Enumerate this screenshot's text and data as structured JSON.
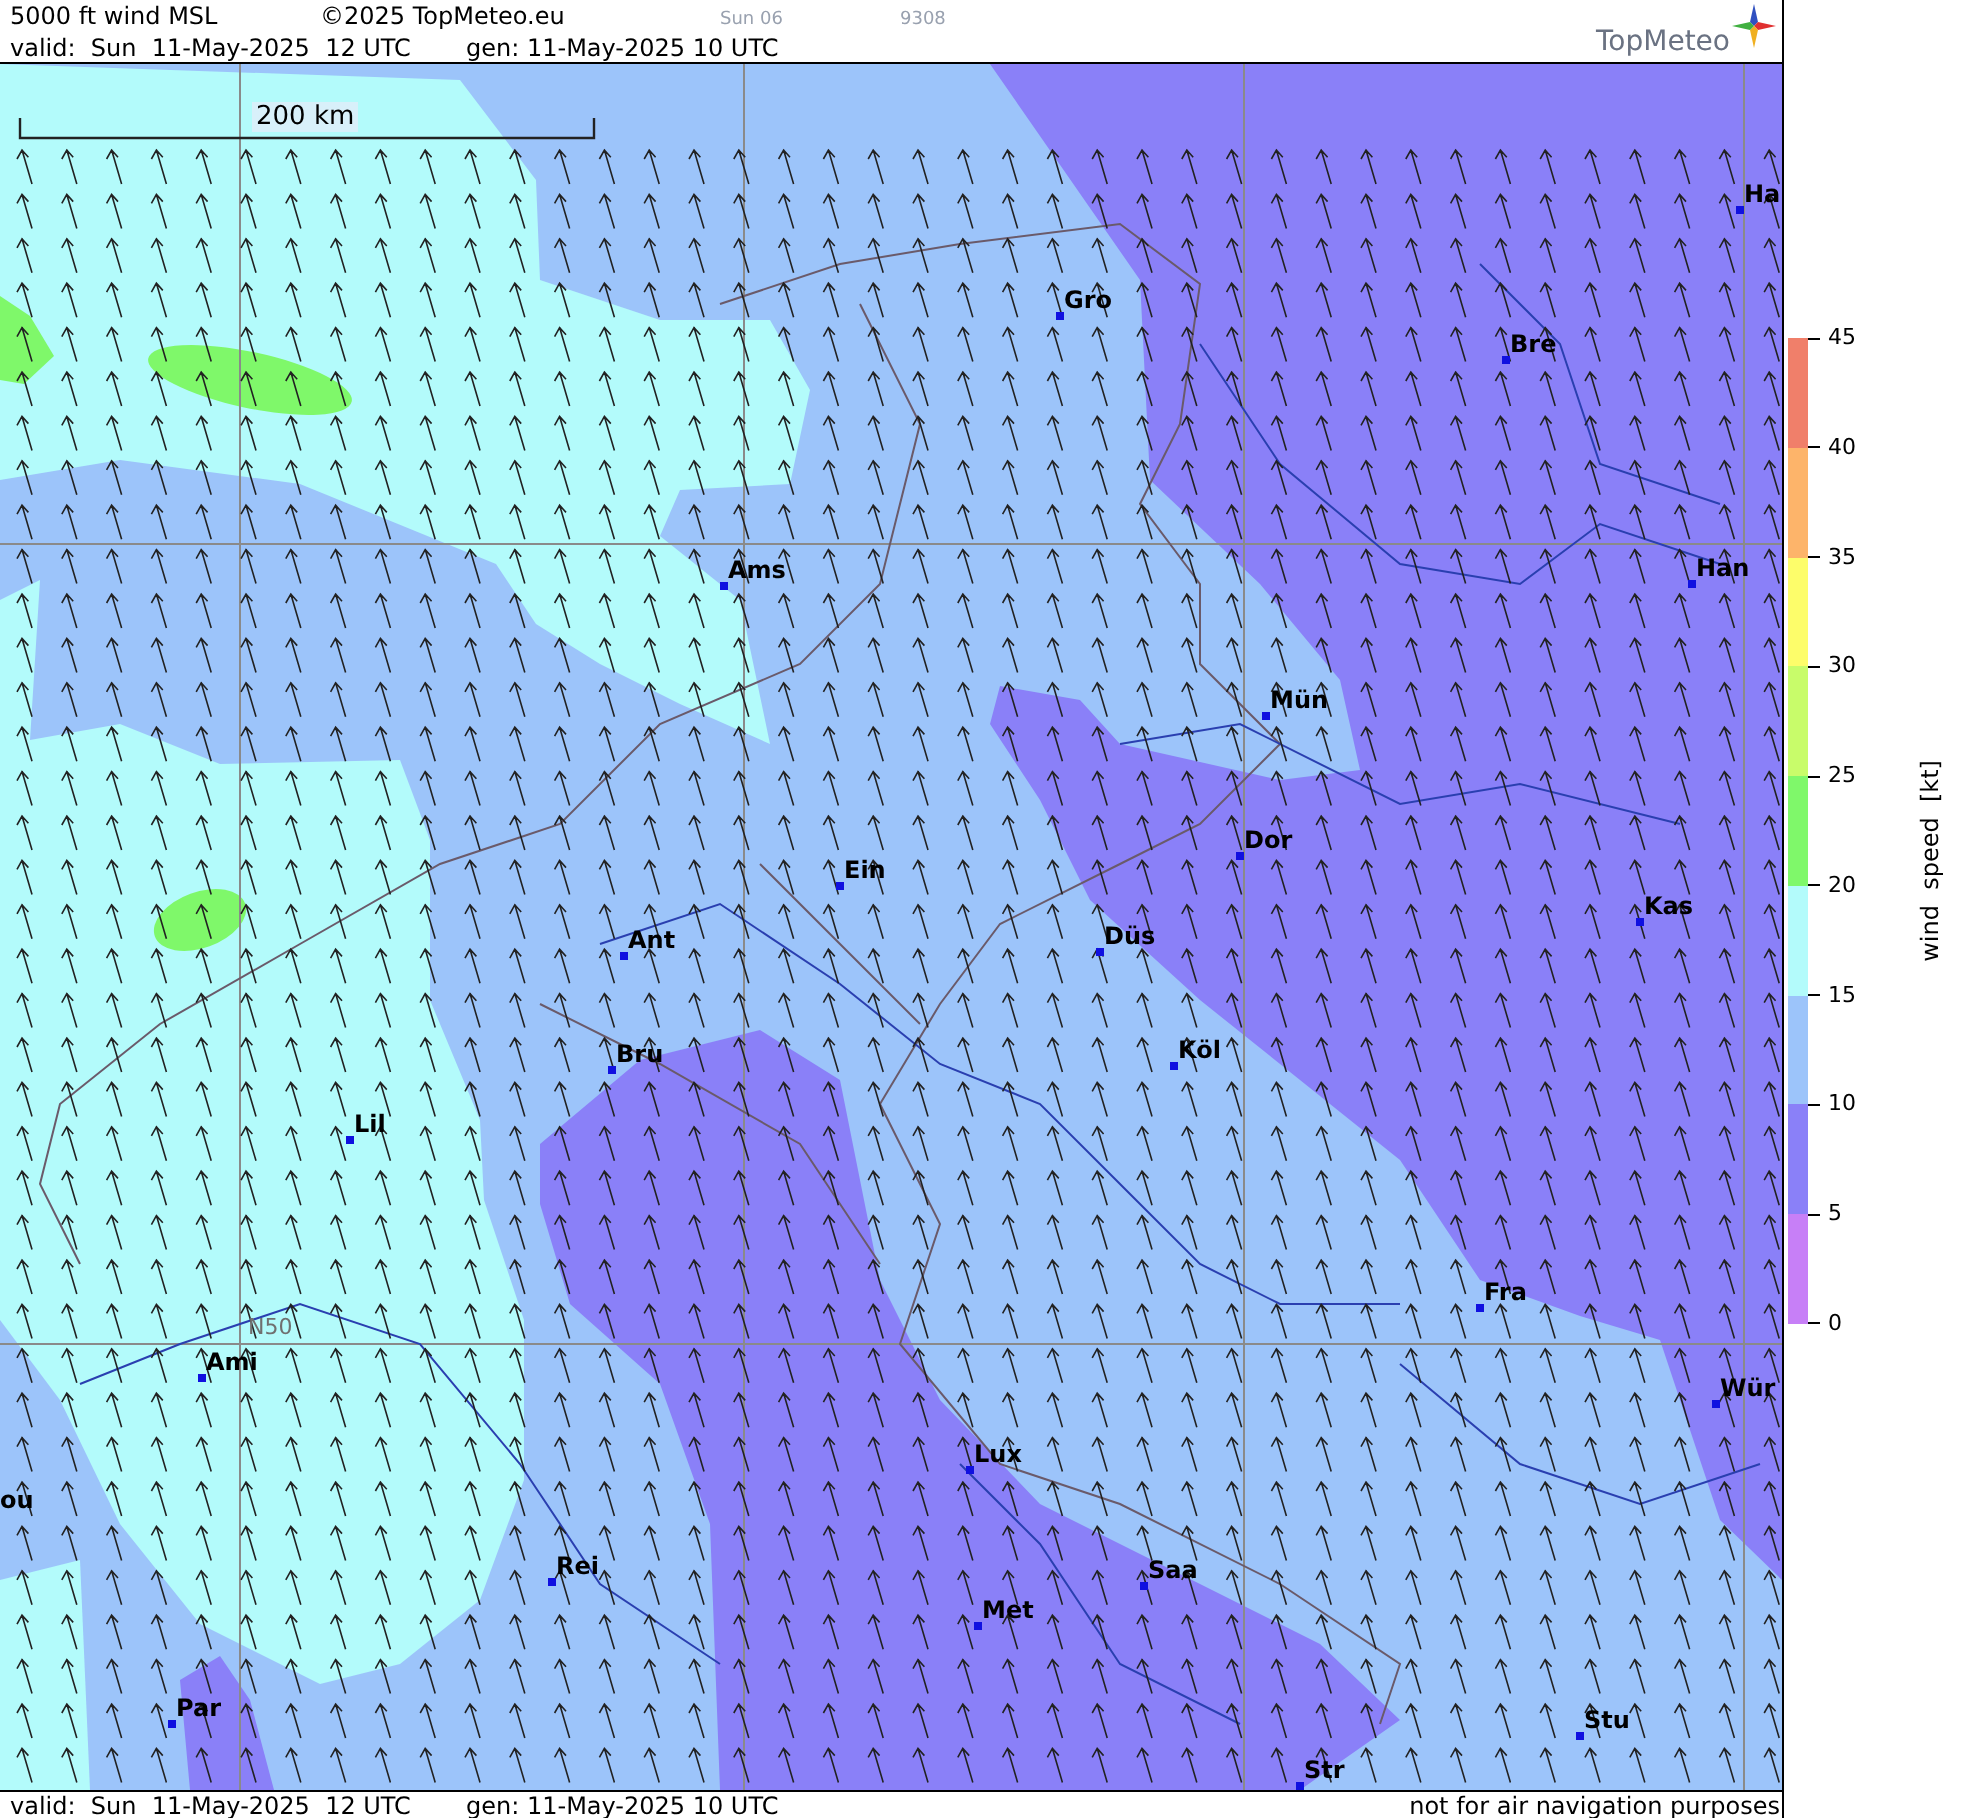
{
  "header": {
    "title": "5000 ft wind MSL",
    "copyright": "©2025 TopMeteo.eu",
    "run": "Sun 06",
    "code": "9308",
    "valid": "valid:  Sun  11-May-2025  12 UTC",
    "generated": "gen: 11-May-2025 10 UTC",
    "logo": "TopMeteo"
  },
  "map": {
    "scale": "200 km",
    "latitude_label": "N50",
    "cities": [
      {
        "name": "Ha"
      },
      {
        "name": "Gro"
      },
      {
        "name": "Bre"
      },
      {
        "name": "Ams"
      },
      {
        "name": "Han"
      },
      {
        "name": "Mün"
      },
      {
        "name": "Dor"
      },
      {
        "name": "Ein"
      },
      {
        "name": "Kas"
      },
      {
        "name": "Düs"
      },
      {
        "name": "Ant"
      },
      {
        "name": "Bru"
      },
      {
        "name": "Köl"
      },
      {
        "name": "Lil"
      },
      {
        "name": "Fra"
      },
      {
        "name": "Ami"
      },
      {
        "name": "Wür"
      },
      {
        "name": "Lux"
      },
      {
        "name": "ou"
      },
      {
        "name": "Rei"
      },
      {
        "name": "Saa"
      },
      {
        "name": "Met"
      },
      {
        "name": "Stu"
      },
      {
        "name": "Par"
      },
      {
        "name": "Str"
      }
    ]
  },
  "legend": {
    "title": "wind speed [kt]",
    "ticks": [
      "45",
      "40",
      "35",
      "30",
      "25",
      "20",
      "15",
      "10",
      "5",
      "0"
    ],
    "bands": [
      {
        "color": "#f07f6a"
      },
      {
        "color": "#fdb46a"
      },
      {
        "color": "#fdfd6a"
      },
      {
        "color": "#c8fc6a"
      },
      {
        "color": "#7ff86a"
      },
      {
        "color": "#b3fbfb"
      },
      {
        "color": "#9cc4fa"
      },
      {
        "color": "#8a80f8"
      },
      {
        "color": "#c77ff7"
      }
    ]
  },
  "footer": {
    "valid": "valid:  Sun  11-May-2025  12 UTC",
    "generated": "gen: 11-May-2025 10 UTC",
    "note": "not for air navigation purposes"
  }
}
